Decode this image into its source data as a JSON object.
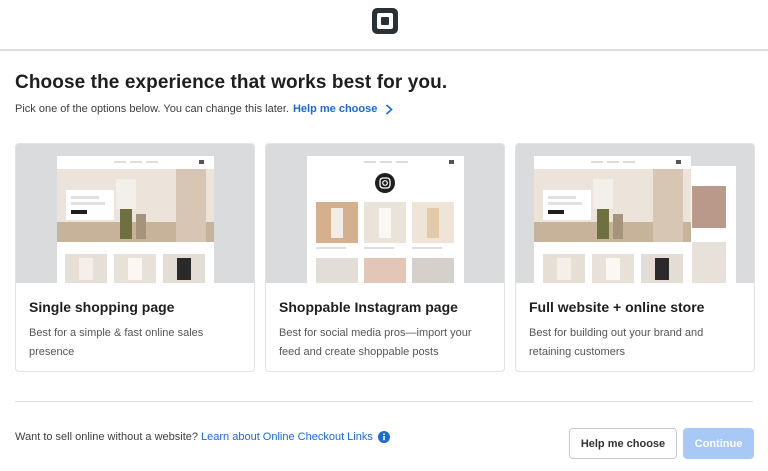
{
  "header": {
    "logo_icon": "square-logo-icon"
  },
  "main": {
    "title": "Choose the experience that works best for you.",
    "subtitle": "Pick one of the options below. You can change this later.",
    "help_link": "Help me choose"
  },
  "options": [
    {
      "title": "Single shopping page",
      "description": "Best for a simple & fast online sales presence"
    },
    {
      "title": "Shoppable Instagram page",
      "description": "Best for social media pros—import your feed and create shoppable posts"
    },
    {
      "title": "Full website + online store",
      "description": "Best for building out your brand and retaining customers"
    }
  ],
  "footer": {
    "question": "Want to sell online without a website?",
    "link": "Learn about Online Checkout Links",
    "help_button": "Help me choose",
    "continue_button": "Continue"
  },
  "colors": {
    "link": "#1a6bd6",
    "primary_disabled": "#a8c9f5",
    "thumb_bg": "#d9dbdc"
  }
}
